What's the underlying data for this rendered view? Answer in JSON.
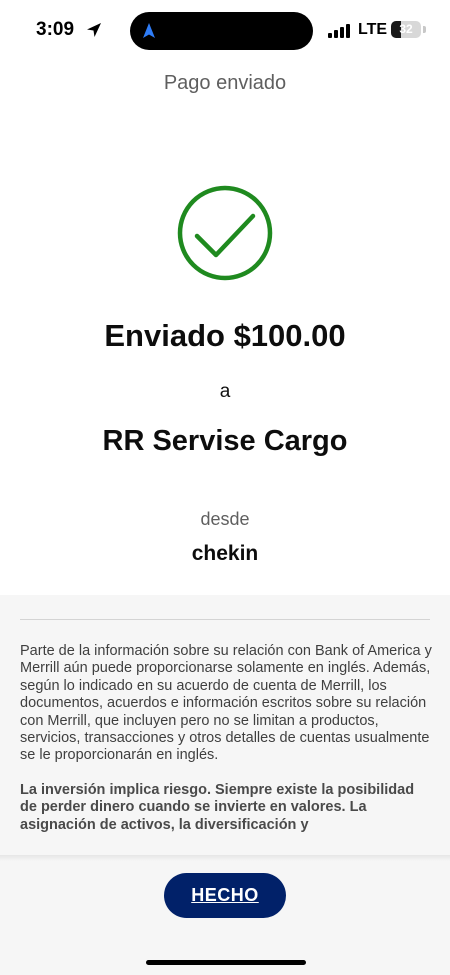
{
  "status_bar": {
    "time": "3:09",
    "network": "LTE",
    "battery_level": "32",
    "battery_fraction": 0.32,
    "signal_bars": 4,
    "icons": [
      "location-arrow-icon",
      "navigation-icon",
      "signal-icon",
      "battery-icon"
    ]
  },
  "header": {
    "title": "Pago enviado"
  },
  "confirmation": {
    "status_icon": "checkmark-circle-icon",
    "icon_color": "#1f8a1f",
    "amount_line": "Enviado $100.00",
    "to_word": "a",
    "recipient": "RR Servise Cargo",
    "from_word": "desde",
    "account": "chekin"
  },
  "disclosure": {
    "paragraph1": "Parte de la información sobre su relación con Bank of America y Merrill aún puede proporcionarse solamente en inglés. Además, según lo indicado en su acuerdo de cuenta de Merrill, los documentos, acuerdos e información escritos sobre su relación con Merrill, que incluyen pero no se limitan a productos, servicios, transacciones y otros detalles de cuentas usualmente se le proporcionarán en inglés.",
    "paragraph2": "La inversión implica riesgo. Siempre existe la posibilidad de perder dinero cuando se invierte en valores. La asignación de activos, la diversificación y"
  },
  "footer": {
    "done_label": "HECHO",
    "button_color": "#012169"
  }
}
